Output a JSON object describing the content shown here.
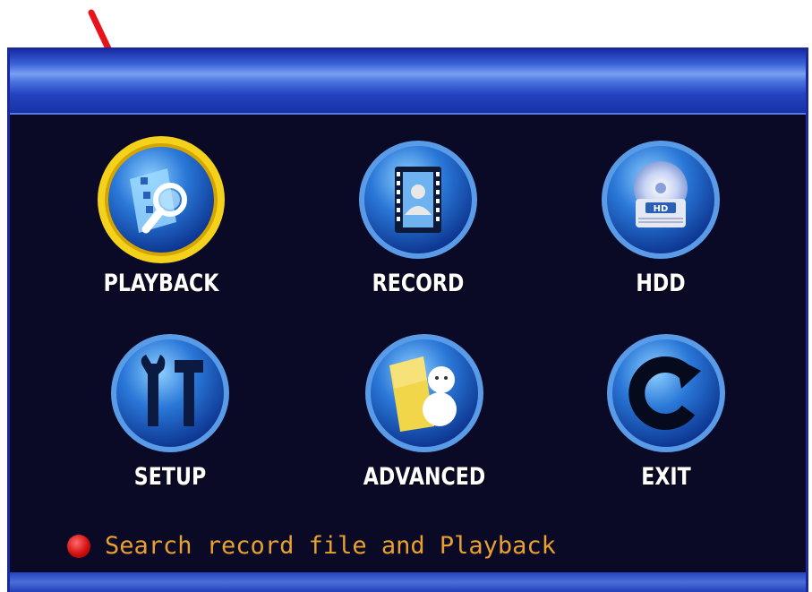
{
  "menu": {
    "items": [
      {
        "label": "PLAYBACK",
        "icon": "playback-icon",
        "selected": true
      },
      {
        "label": "RECORD",
        "icon": "record-icon",
        "selected": false
      },
      {
        "label": "HDD",
        "icon": "hdd-icon",
        "selected": false
      },
      {
        "label": "SETUP",
        "icon": "setup-icon",
        "selected": false
      },
      {
        "label": "ADVANCED",
        "icon": "advanced-icon",
        "selected": false
      },
      {
        "label": "EXIT",
        "icon": "exit-icon",
        "selected": false
      }
    ]
  },
  "status": {
    "text": "Search record file and Playback"
  },
  "hdd_badge": "HD",
  "colors": {
    "background": "#0b0a26",
    "title_bar": "#2443c0",
    "selection_ring": "#f4d21c",
    "status_text": "#e8a030",
    "annotation_arrow": "#e8141c"
  }
}
